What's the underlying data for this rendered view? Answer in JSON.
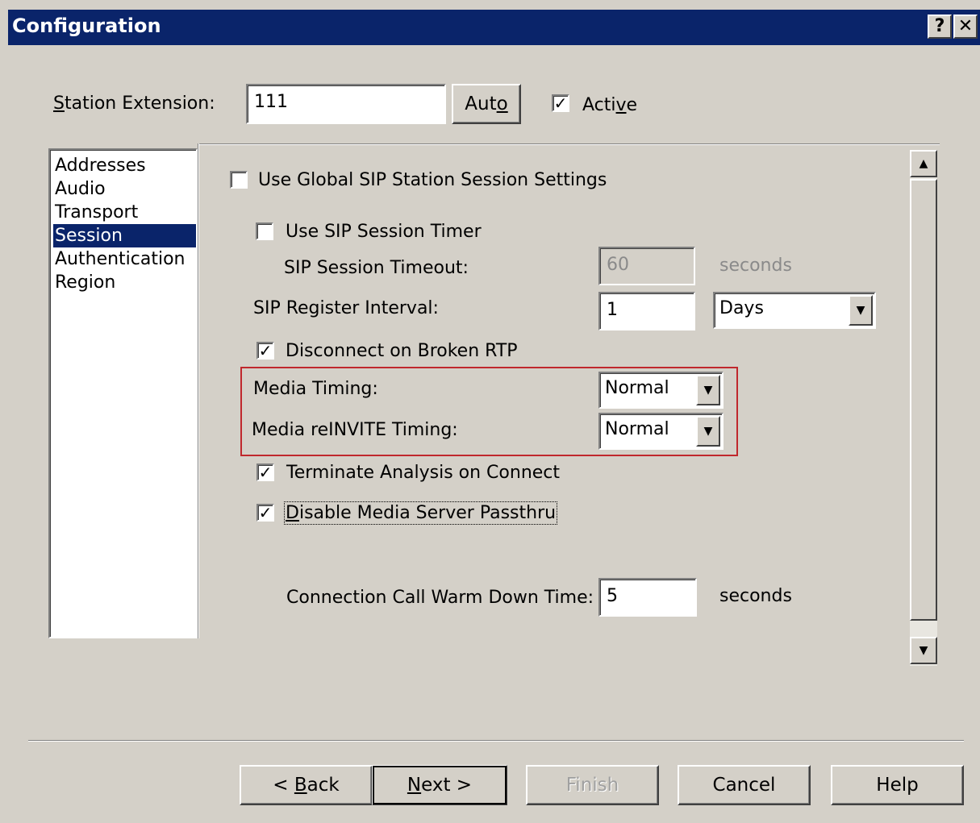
{
  "window": {
    "title": "Configuration",
    "help_glyph": "?",
    "close_glyph": "✕"
  },
  "header": {
    "station_extension_label_accel": "S",
    "station_extension_label_rest": "tation Extension:",
    "station_extension_value": "111",
    "auto_button_pre": "Aut",
    "auto_button_accel": "o",
    "active_checked": true,
    "active_label_pre": "Acti",
    "active_label_accel": "v",
    "active_label_post": "e"
  },
  "sidebar": {
    "items": [
      {
        "label": "Addresses",
        "selected": false
      },
      {
        "label": "Audio",
        "selected": false
      },
      {
        "label": "Transport",
        "selected": false
      },
      {
        "label": "Session",
        "selected": true
      },
      {
        "label": "Authentication",
        "selected": false
      },
      {
        "label": "Region",
        "selected": false
      }
    ]
  },
  "session": {
    "use_global_label": "Use Global SIP Station Session Settings",
    "use_global_checked": false,
    "use_timer_label": "Use SIP Session Timer",
    "use_timer_checked": false,
    "timeout_label": "SIP Session Timeout:",
    "timeout_value": "60",
    "timeout_unit": "seconds",
    "register_label": "SIP Register Interval:",
    "register_value": "1",
    "register_unit": "Days",
    "disconnect_label": "Disconnect on Broken RTP",
    "disconnect_checked": true,
    "media_timing_label": "Media Timing:",
    "media_timing_value": "Normal",
    "media_reinvite_label": "Media reINVITE Timing:",
    "media_reinvite_value": "Normal",
    "terminate_label": "Terminate Analysis on Connect",
    "terminate_checked": true,
    "disable_passthru_accel": "D",
    "disable_passthru_rest": "isable Media Server Passthru",
    "disable_passthru_checked": true,
    "warm_down_label": "Connection Call Warm Down Time:",
    "warm_down_value": "5",
    "warm_down_unit": "seconds"
  },
  "footer": {
    "back_pre": "< ",
    "back_accel": "B",
    "back_post": "ack",
    "next_accel": "N",
    "next_post": "ext >",
    "finish_label": "Finish",
    "cancel_label": "Cancel",
    "help_label": "Help"
  },
  "icons": {
    "check_glyph": "✓",
    "dropdown_arrow_glyph": "▼",
    "scroll_up_glyph": "▲",
    "scroll_down_glyph": "▼"
  },
  "colors": {
    "title_bar": "#0a246a",
    "selection": "#0a246a",
    "highlight_box": "#c0282d",
    "face": "#d4d0c8"
  }
}
